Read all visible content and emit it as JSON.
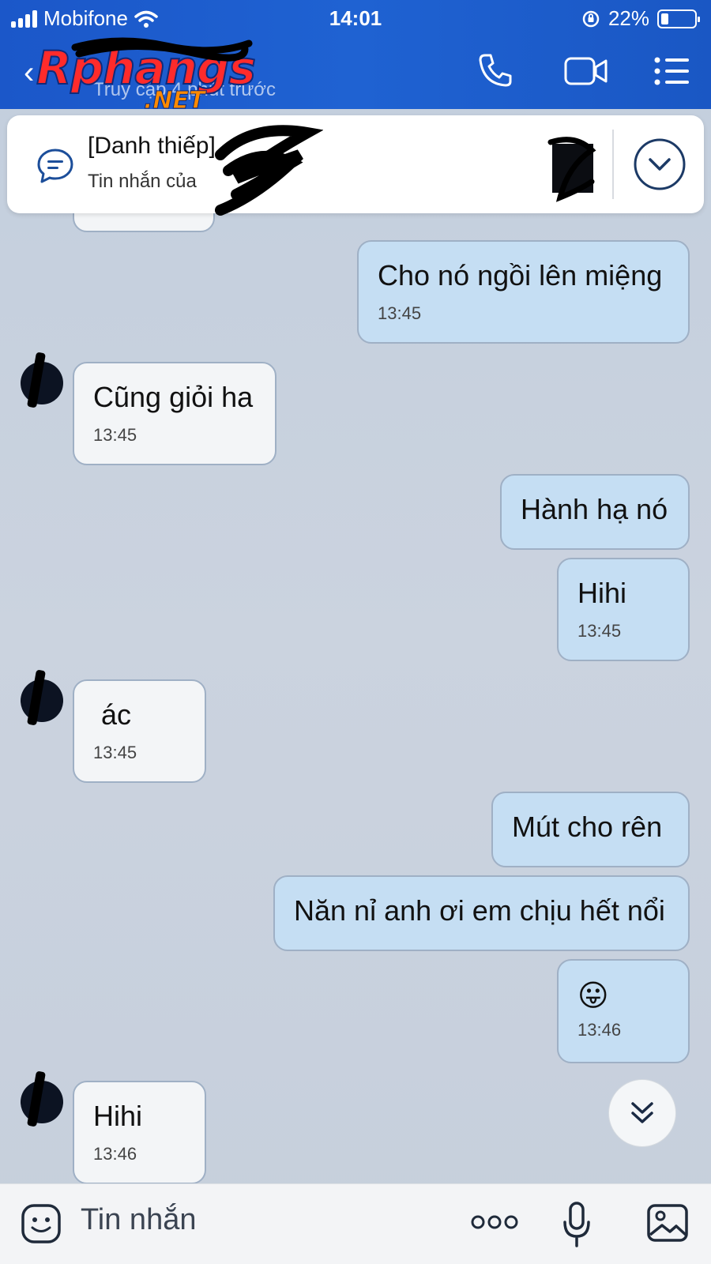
{
  "status_bar": {
    "carrier": "Mobifone",
    "time": "14:01",
    "battery": "22%",
    "battery_fraction": 0.22
  },
  "header": {
    "logo_main": "Rphangs",
    "logo_suffix": ".NET",
    "last_seen": "Truy cập 4 phút trước",
    "icons": [
      "back-icon",
      "phone-icon",
      "video-call-icon",
      "menu-icon"
    ]
  },
  "pinned": {
    "title": "[Danh thiếp]",
    "subtitle": "Tin nhắn của",
    "icons": [
      "chat-bubble-icon",
      "chevron-down-icon"
    ]
  },
  "messages": [
    {
      "side": "out",
      "text": "Cho nó ngồi lên miệng",
      "time": "13:45"
    },
    {
      "side": "in",
      "text": "Cũng giỏi ha",
      "time": "13:45"
    },
    {
      "side": "out",
      "text": "Hành hạ nó",
      "time": ""
    },
    {
      "side": "out",
      "text": "Hihi",
      "time": "13:45"
    },
    {
      "side": "in",
      "text": "ác",
      "time": "13:45"
    },
    {
      "side": "out",
      "text": "Mút cho rên",
      "time": ""
    },
    {
      "side": "out",
      "text": "Năn nỉ anh ơi em chịu hết nổi",
      "time": ""
    },
    {
      "side": "out",
      "text": "😛",
      "time": "13:46"
    },
    {
      "side": "in",
      "text": "Hihi",
      "time": "13:46"
    }
  ],
  "composer": {
    "placeholder": "Tin nhắn",
    "icons": [
      "emoji-icon",
      "more-icon",
      "microphone-icon",
      "image-icon"
    ]
  },
  "colors": {
    "header_bg": "#1f62d2",
    "outgoing_bubble": "#c5def3",
    "incoming_bubble": "#f3f5f7",
    "chat_bg": "#c6cfdc"
  }
}
